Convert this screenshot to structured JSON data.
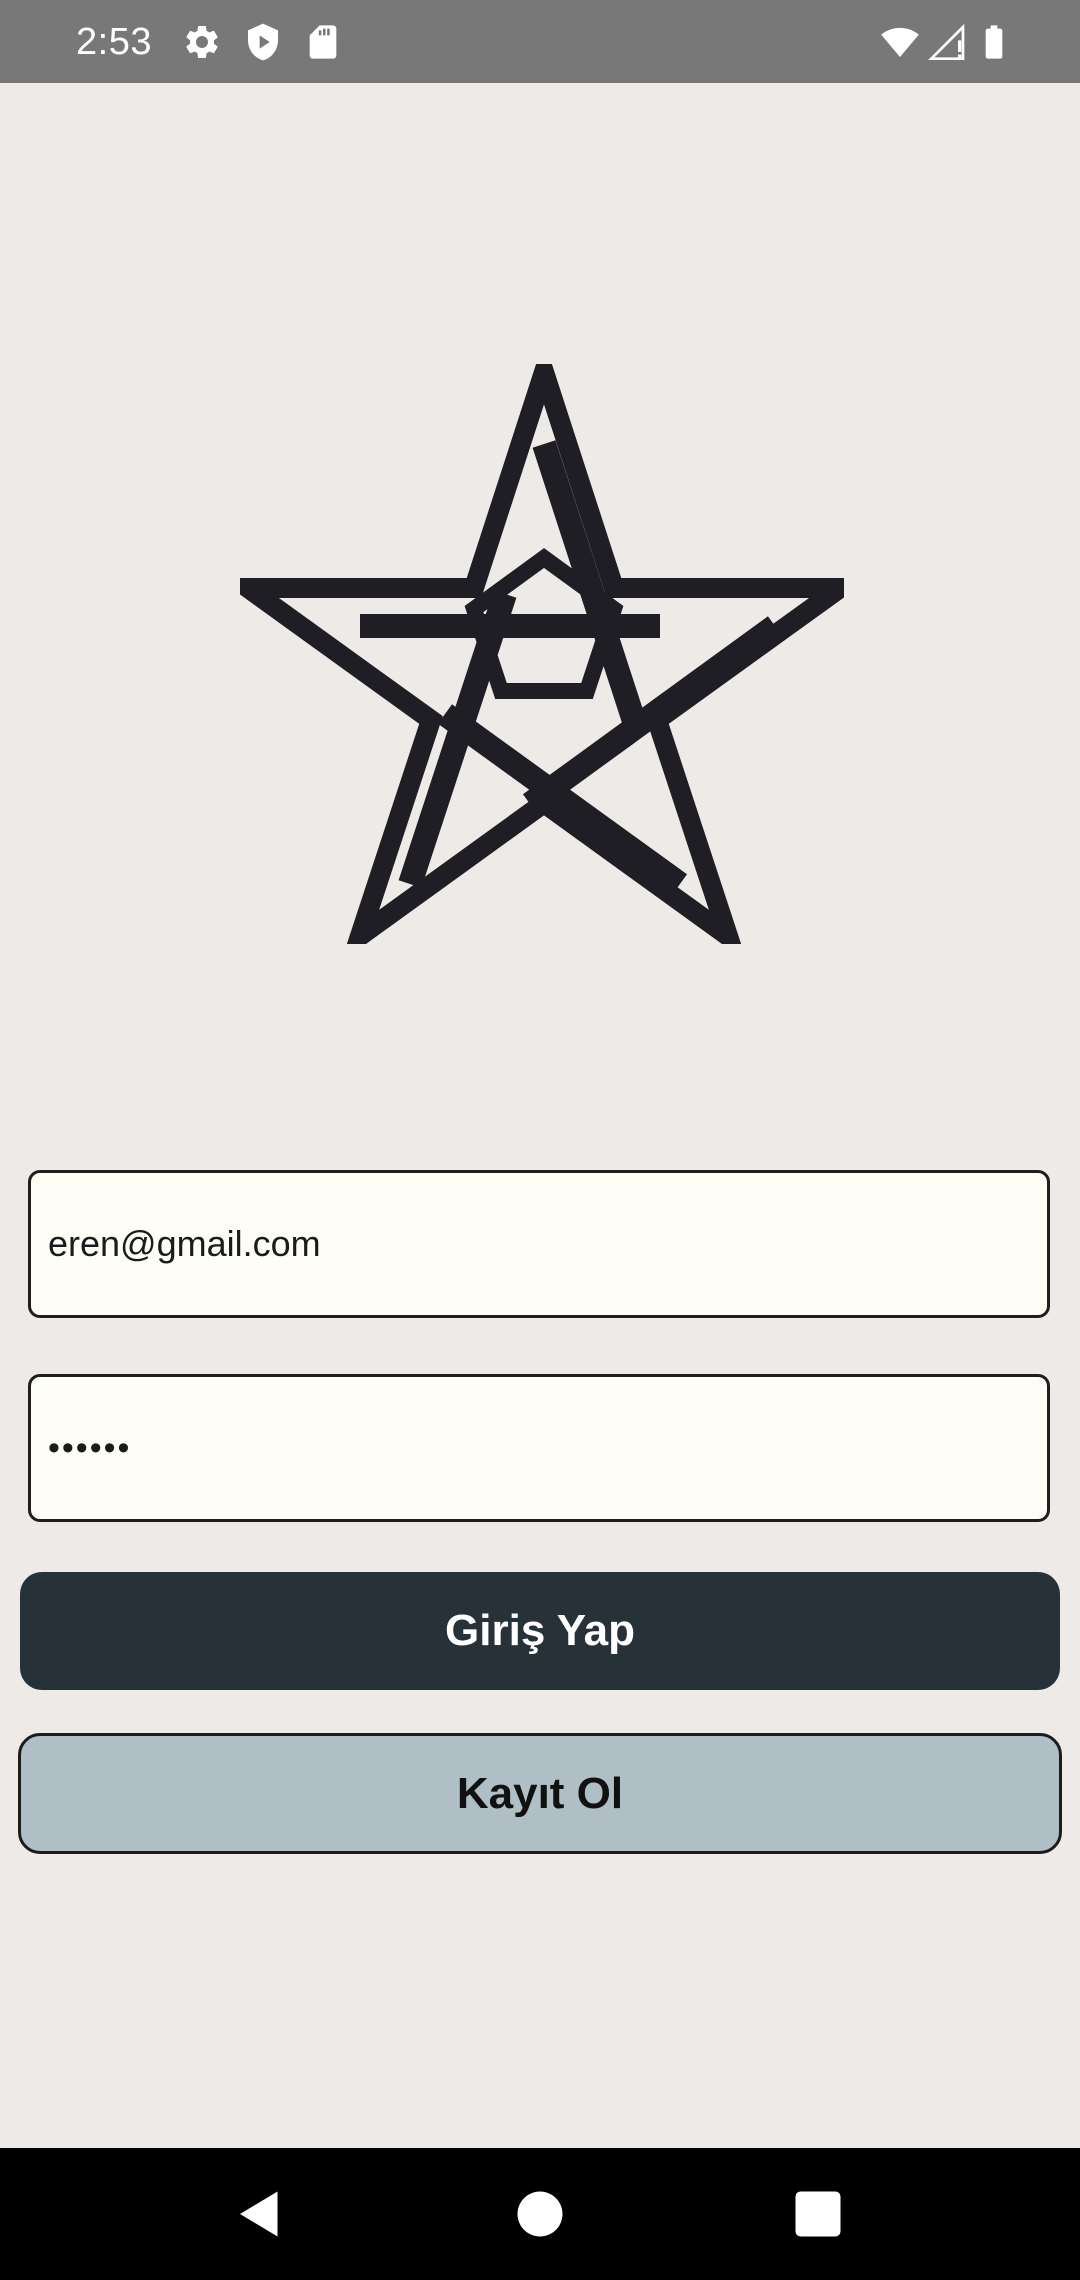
{
  "status_bar": {
    "time": "2:53",
    "icons": [
      "gear-icon",
      "shield-play-icon",
      "sd-card-icon",
      "wifi-icon",
      "cell-signal-icon",
      "battery-icon"
    ]
  },
  "logo": {
    "icon": "star-logo-icon",
    "color": "#1E1E24"
  },
  "login_form": {
    "email_value": "eren@gmail.com",
    "password_value": "••••••",
    "login_button_label": "Giriş Yap",
    "register_button_label": "Kayıt Ol"
  },
  "colors": {
    "background": "#EEEAE8",
    "field_background": "#FFFEF6",
    "login_button": "#263238",
    "register_button": "#B0BEC5",
    "status_bar": "#787878",
    "nav_bar": "#000000"
  },
  "nav_bar": {
    "icons": [
      "back-icon",
      "home-icon",
      "recents-icon"
    ]
  }
}
